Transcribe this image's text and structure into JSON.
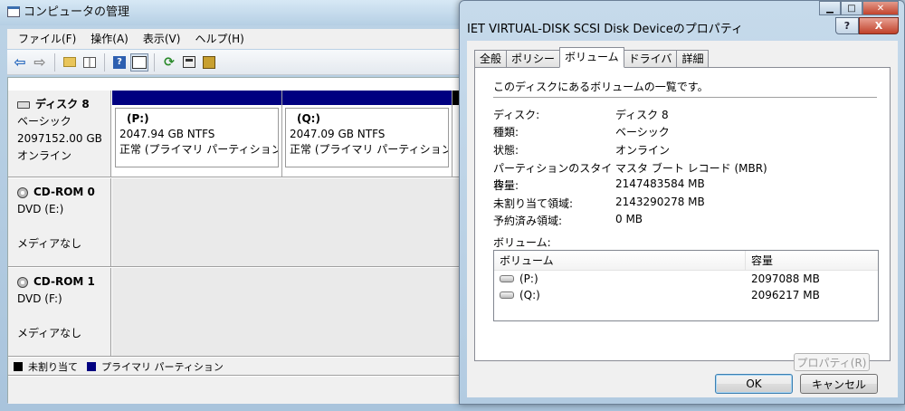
{
  "main": {
    "title": "コンピュータの管理",
    "menu": [
      "ファイル(F)",
      "操作(A)",
      "表示(V)",
      "ヘルプ(H)"
    ],
    "disks": [
      {
        "name": "ディスク 8",
        "type": "ベーシック",
        "size": "2097152.00 GB",
        "status": "オンライン"
      },
      {
        "name": "CD-ROM 0",
        "type": "DVD (E:)",
        "status": "メディアなし"
      },
      {
        "name": "CD-ROM 1",
        "type": "DVD (F:)",
        "status": "メディアなし"
      }
    ],
    "partitions": [
      {
        "name": "(P:)",
        "size": "2047.94 GB NTFS",
        "status": "正常 (プライマリ パーティション)"
      },
      {
        "name": "(Q:)",
        "size": "2047.09 GB NTFS",
        "status": "正常 (プライマリ パーティション)"
      }
    ],
    "legend": [
      {
        "label": "未割り当て",
        "color": "#000000"
      },
      {
        "label": "プライマリ パーティション",
        "color": "#000080"
      }
    ]
  },
  "dialog": {
    "title": "IET VIRTUAL-DISK SCSI Disk Deviceのプロパティ",
    "help_label": "?",
    "close_label": "X",
    "tabs": [
      "全般",
      "ポリシー",
      "ボリューム",
      "ドライバ",
      "詳細"
    ],
    "active_tab": "ボリューム",
    "description": "このディスクにあるボリュームの一覧です。",
    "fields": [
      {
        "label": "ディスク:",
        "value": "ディスク 8"
      },
      {
        "label": "種類:",
        "value": "ベーシック"
      },
      {
        "label": "状態:",
        "value": "オンライン"
      },
      {
        "label": "パーティションのスタイル:",
        "value": "マスタ ブート レコード (MBR)"
      },
      {
        "label": "容量:",
        "value": "2147483584 MB"
      },
      {
        "label": "未割り当て領域:",
        "value": "2143290278 MB"
      },
      {
        "label": "予約済み領域:",
        "value": "0 MB"
      }
    ],
    "volumes_label": "ボリューム:",
    "volumes_columns": [
      "ボリューム",
      "容量"
    ],
    "volumes": [
      {
        "name": "(P:)",
        "capacity": "2097088 MB"
      },
      {
        "name": "(Q:)",
        "capacity": "2096217 MB"
      }
    ],
    "properties_button": "プロパティ(R)",
    "ok_button": "OK",
    "cancel_button": "キャンセル"
  }
}
